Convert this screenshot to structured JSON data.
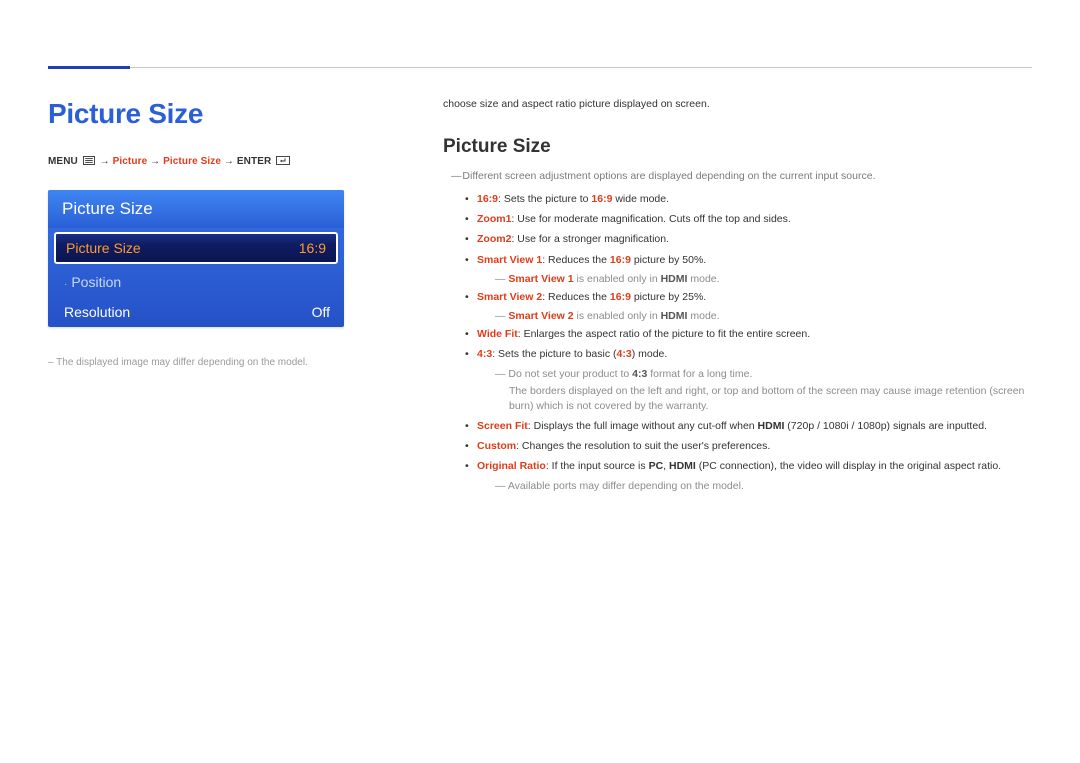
{
  "page": {
    "title": "Picture Size"
  },
  "breadcrumb": {
    "menu": "MENU",
    "arrow": "→",
    "picture": "Picture",
    "picture_size": "Picture Size",
    "enter": "ENTER"
  },
  "osd": {
    "title": "Picture Size",
    "rows": [
      {
        "label": "Picture Size",
        "value": "16:9",
        "state": "selected"
      },
      {
        "label": "Position",
        "value": "",
        "state": "dim",
        "cursor": true
      },
      {
        "label": "Resolution",
        "value": "Off",
        "state": "normal"
      }
    ]
  },
  "left_footnote": "The displayed image may differ depending on the model.",
  "right": {
    "intro": "choose size and aspect ratio picture displayed on screen.",
    "section_title": "Picture Size",
    "top_note": "Different screen adjustment options are displayed depending on the current input source.",
    "items": [
      {
        "key": "16:9",
        "text": ": Sets the picture to ",
        "key2": "16:9",
        "tail": " wide mode."
      },
      {
        "key": "Zoom1",
        "text": ": Use for moderate magnification. Cuts off the top and sides."
      },
      {
        "key": "Zoom2",
        "text": ": Use for a stronger magnification."
      },
      {
        "key": "Smart View 1",
        "text": ": Reduces the ",
        "key2": "16:9",
        "tail": " picture by 50%.",
        "note": {
          "key": "Smart View 1",
          "mid": " is enabled only in ",
          "key2": "HDMI",
          "tail": " mode."
        }
      },
      {
        "key": "Smart View 2",
        "text": ": Reduces the ",
        "key2": "16:9",
        "tail": " picture by 25%.",
        "note": {
          "key": "Smart View 2",
          "mid": " is enabled only in ",
          "key2": "HDMI",
          "tail": " mode."
        }
      },
      {
        "key": "Wide Fit",
        "text": ": Enlarges the aspect ratio of the picture to fit the entire screen."
      },
      {
        "key": "4:3",
        "text": ": Sets the picture to basic (",
        "key2": "4:3",
        "tail": ") mode.",
        "note_plain": "Do not set your product to ",
        "note_key": "4:3",
        "note_tail": " format for a long time.",
        "note_body": "The borders displayed on the left and right, or top and bottom of the screen may cause image retention (screen burn) which is not covered by the warranty."
      },
      {
        "key": "Screen Fit",
        "text": ": Displays the full image without any cut-off when ",
        "key2b": "HDMI",
        "tail": " (720p / 1080i / 1080p) signals are inputted."
      },
      {
        "key": "Custom",
        "text": ": Changes the resolution to suit the user's preferences."
      },
      {
        "key": "Original Ratio",
        "text": ": If the input source is ",
        "key2b": "PC",
        "mid2": ", ",
        "key3b": "HDMI",
        "tail": " (PC connection), the video will display in the original aspect ratio.",
        "note_after": "Available ports may differ depending on the model."
      }
    ]
  }
}
